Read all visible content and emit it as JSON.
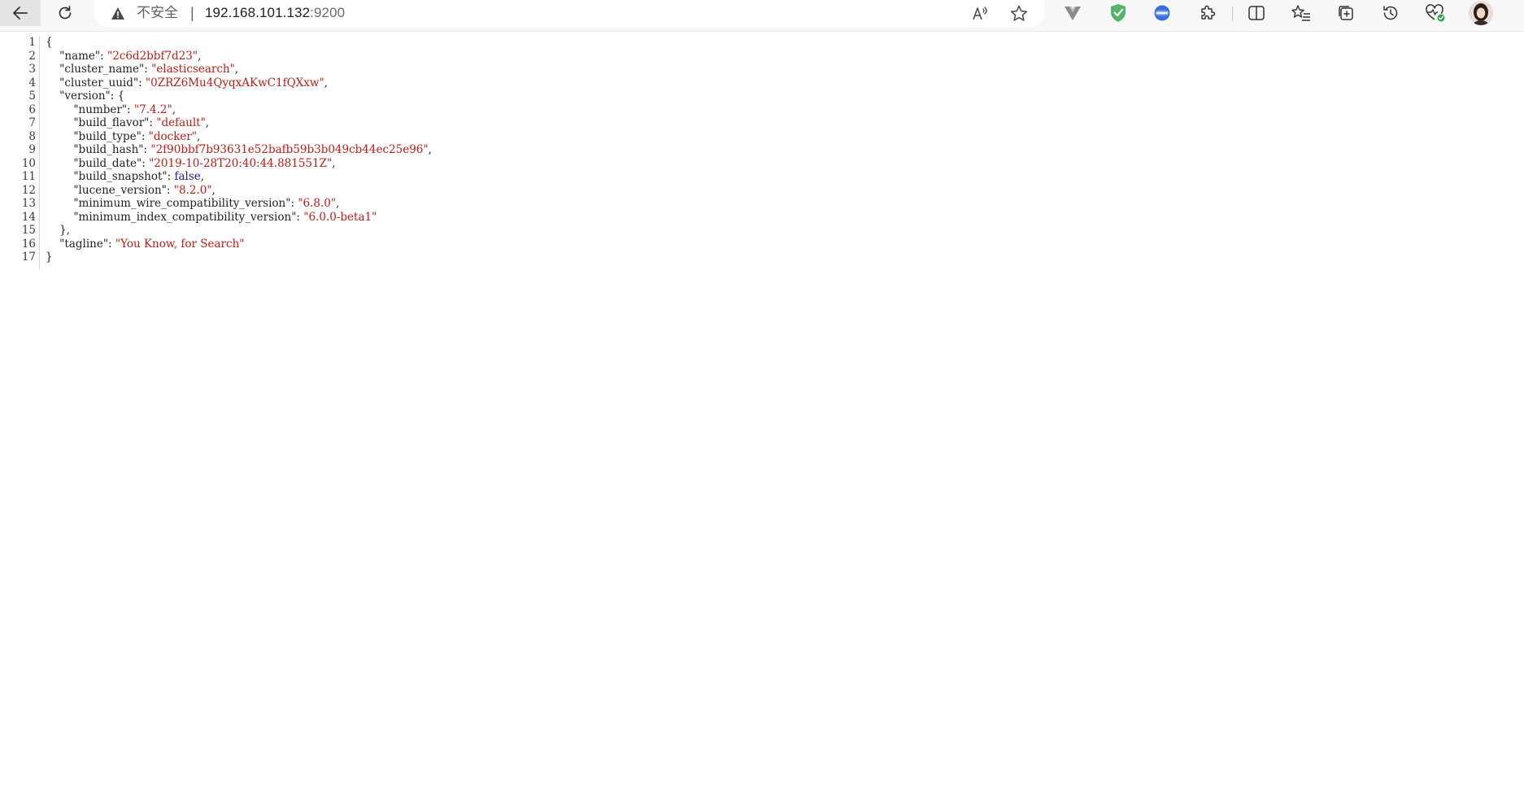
{
  "browser": {
    "insecure_label": "不安全",
    "separator": "|",
    "url_host": "192.168.101.132",
    "url_port": ":9200",
    "icons": [
      "back-arrow-icon",
      "reload-icon",
      "warning-icon",
      "read-aloud-icon",
      "favorite-star-icon",
      "vue-devtools-icon",
      "adguard-shield-icon",
      "extension-badge-icon",
      "puzzle-extensions-icon",
      "split-screen-icon",
      "favorites-list-icon",
      "collections-icon",
      "history-icon",
      "browser-essentials-icon"
    ]
  },
  "json_lines": [
    {
      "n": "1",
      "t": "{"
    },
    {
      "n": "2",
      "t": "    \"name\": \"2c6d2bbf7d23\","
    },
    {
      "n": "3",
      "t": "    \"cluster_name\": \"elasticsearch\","
    },
    {
      "n": "4",
      "t": "    \"cluster_uuid\": \"0ZRZ6Mu4QyqxAKwC1fQXxw\","
    },
    {
      "n": "5",
      "t": "    \"version\": {"
    },
    {
      "n": "6",
      "t": "        \"number\": \"7.4.2\","
    },
    {
      "n": "7",
      "t": "        \"build_flavor\": \"default\","
    },
    {
      "n": "8",
      "t": "        \"build_type\": \"docker\","
    },
    {
      "n": "9",
      "t": "        \"build_hash\": \"2f90bbf7b93631e52bafb59b3b049cb44ec25e96\","
    },
    {
      "n": "10",
      "t": "        \"build_date\": \"2019-10-28T20:40:44.881551Z\","
    },
    {
      "n": "11",
      "t": "        \"build_snapshot\": false,"
    },
    {
      "n": "12",
      "t": "        \"lucene_version\": \"8.2.0\","
    },
    {
      "n": "13",
      "t": "        \"minimum_wire_compatibility_version\": \"6.8.0\","
    },
    {
      "n": "14",
      "t": "        \"minimum_index_compatibility_version\": \"6.0.0-beta1\""
    },
    {
      "n": "15",
      "t": "    },"
    },
    {
      "n": "16",
      "t": "    \"tagline\": \"You Know, for Search\""
    },
    {
      "n": "17",
      "t": "}"
    }
  ]
}
